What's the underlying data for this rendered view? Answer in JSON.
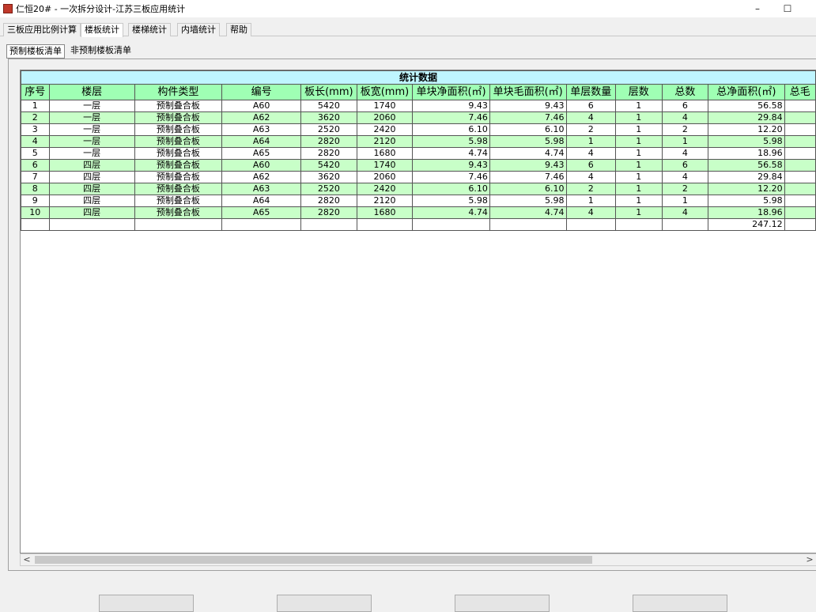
{
  "window": {
    "title": "仁恒20#  -  一次拆分设计-江苏三板应用统计",
    "controls": [
      "–",
      "☐",
      ""
    ]
  },
  "menu": [
    {
      "label": "三板应用比例计算",
      "active": false
    },
    {
      "label": "楼板统计",
      "active": true
    },
    {
      "label": "楼梯统计",
      "active": false
    },
    {
      "label": "内墙统计",
      "active": false
    },
    {
      "label": "帮助",
      "active": false
    }
  ],
  "subtabs": [
    {
      "label": "预制楼板清单",
      "active": true
    },
    {
      "label": "非预制楼板清单",
      "active": false
    }
  ],
  "grid": {
    "band_title": "统计数据",
    "columns": [
      "序号",
      "楼层",
      "构件类型",
      "编号",
      "板长(mm)",
      "板宽(mm)",
      "单块净面积(㎡)",
      "单块毛面积(㎡)",
      "单层数量",
      "层数",
      "总数",
      "总净面积(㎡)",
      "总毛"
    ],
    "rows": [
      [
        "1",
        "一层",
        "预制叠合板",
        "A60",
        "5420",
        "1740",
        "9.43",
        "9.43",
        "6",
        "1",
        "6",
        "56.58",
        ""
      ],
      [
        "2",
        "一层",
        "预制叠合板",
        "A62",
        "3620",
        "2060",
        "7.46",
        "7.46",
        "4",
        "1",
        "4",
        "29.84",
        ""
      ],
      [
        "3",
        "一层",
        "预制叠合板",
        "A63",
        "2520",
        "2420",
        "6.10",
        "6.10",
        "2",
        "1",
        "2",
        "12.20",
        ""
      ],
      [
        "4",
        "一层",
        "预制叠合板",
        "A64",
        "2820",
        "2120",
        "5.98",
        "5.98",
        "1",
        "1",
        "1",
        "5.98",
        ""
      ],
      [
        "5",
        "一层",
        "预制叠合板",
        "A65",
        "2820",
        "1680",
        "4.74",
        "4.74",
        "4",
        "1",
        "4",
        "18.96",
        ""
      ],
      [
        "6",
        "四层",
        "预制叠合板",
        "A60",
        "5420",
        "1740",
        "9.43",
        "9.43",
        "6",
        "1",
        "6",
        "56.58",
        ""
      ],
      [
        "7",
        "四层",
        "预制叠合板",
        "A62",
        "3620",
        "2060",
        "7.46",
        "7.46",
        "4",
        "1",
        "4",
        "29.84",
        ""
      ],
      [
        "8",
        "四层",
        "预制叠合板",
        "A63",
        "2520",
        "2420",
        "6.10",
        "6.10",
        "2",
        "1",
        "2",
        "12.20",
        ""
      ],
      [
        "9",
        "四层",
        "预制叠合板",
        "A64",
        "2820",
        "2120",
        "5.98",
        "5.98",
        "1",
        "1",
        "1",
        "5.98",
        ""
      ],
      [
        "10",
        "四层",
        "预制叠合板",
        "A65",
        "2820",
        "1680",
        "4.74",
        "4.74",
        "4",
        "1",
        "4",
        "18.96",
        ""
      ]
    ],
    "total_row": [
      "",
      "",
      "",
      "",
      "",
      "",
      "",
      "",
      "",
      "",
      "",
      "247.12",
      ""
    ]
  },
  "scrollbar": {
    "left_arrow": "<",
    "right_arrow": ">"
  },
  "footer_buttons": [
    "",
    "",
    "",
    ""
  ],
  "colors": {
    "header_green": "#9fffb4",
    "band_cyan": "#bff5ff",
    "row_alt_green": "#c8ffc8"
  }
}
